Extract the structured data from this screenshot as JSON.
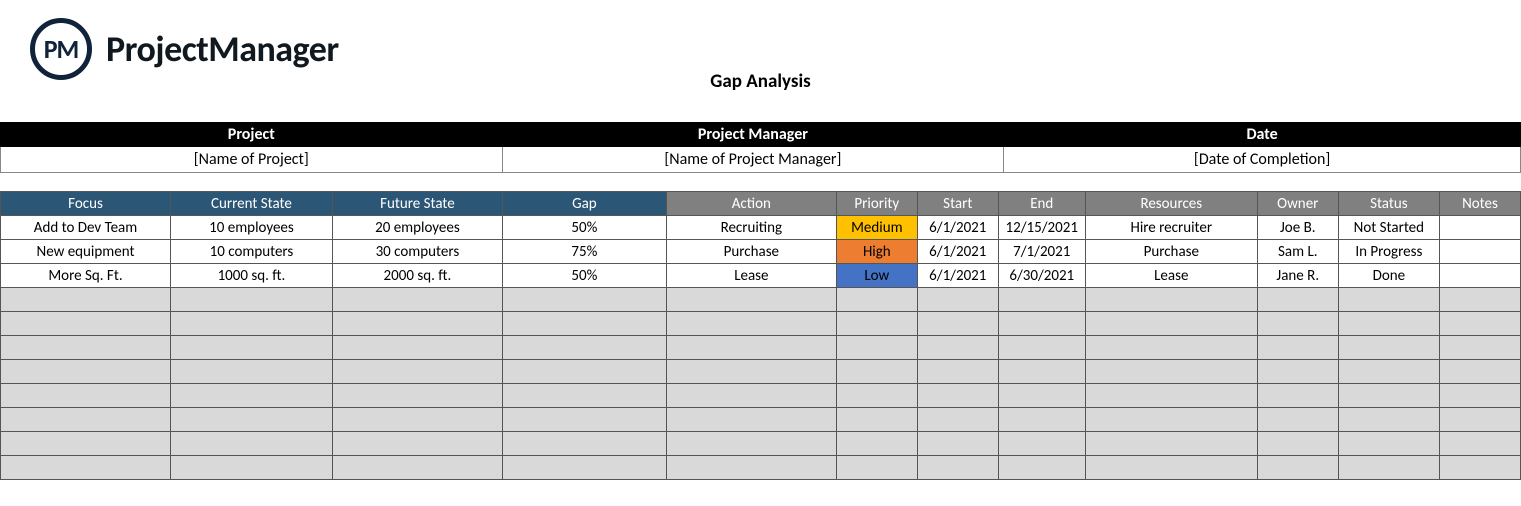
{
  "brand": {
    "logo_initials": "PM",
    "logo_text": "ProjectManager"
  },
  "title": "Gap Analysis",
  "meta": {
    "headers": {
      "project": "Project",
      "pm": "Project Manager",
      "date": "Date"
    },
    "values": {
      "project": "[Name of Project]",
      "pm": "[Name of Project Manager]",
      "date": "[Date of Completion]"
    }
  },
  "columns": {
    "focus": "Focus",
    "current": "Current State",
    "future": "Future State",
    "gap": "Gap",
    "action": "Action",
    "priority": "Priority",
    "start": "Start",
    "end": "End",
    "resources": "Resources",
    "owner": "Owner",
    "status": "Status",
    "notes": "Notes"
  },
  "rows": [
    {
      "focus": "Add to Dev Team",
      "current": "10 employees",
      "future": "20 employees",
      "gap": "50%",
      "action": "Recruiting",
      "priority": "Medium",
      "priority_color": "med",
      "start": "6/1/2021",
      "end": "12/15/2021",
      "resources": "Hire recruiter",
      "owner": "Joe B.",
      "status": "Not Started",
      "notes": ""
    },
    {
      "focus": "New equipment",
      "current": "10 computers",
      "future": "30 computers",
      "gap": "75%",
      "action": "Purchase",
      "priority": "High",
      "priority_color": "high",
      "start": "6/1/2021",
      "end": "7/1/2021",
      "resources": "Purchase",
      "owner": "Sam L.",
      "status": "In Progress",
      "notes": ""
    },
    {
      "focus": "More Sq. Ft.",
      "current": "1000 sq. ft.",
      "future": "2000 sq. ft.",
      "gap": "50%",
      "action": "Lease",
      "priority": "Low",
      "priority_color": "low",
      "start": "6/1/2021",
      "end": "6/30/2021",
      "resources": "Lease",
      "owner": "Jane R.",
      "status": "Done",
      "notes": ""
    }
  ],
  "empty_rows": 8
}
